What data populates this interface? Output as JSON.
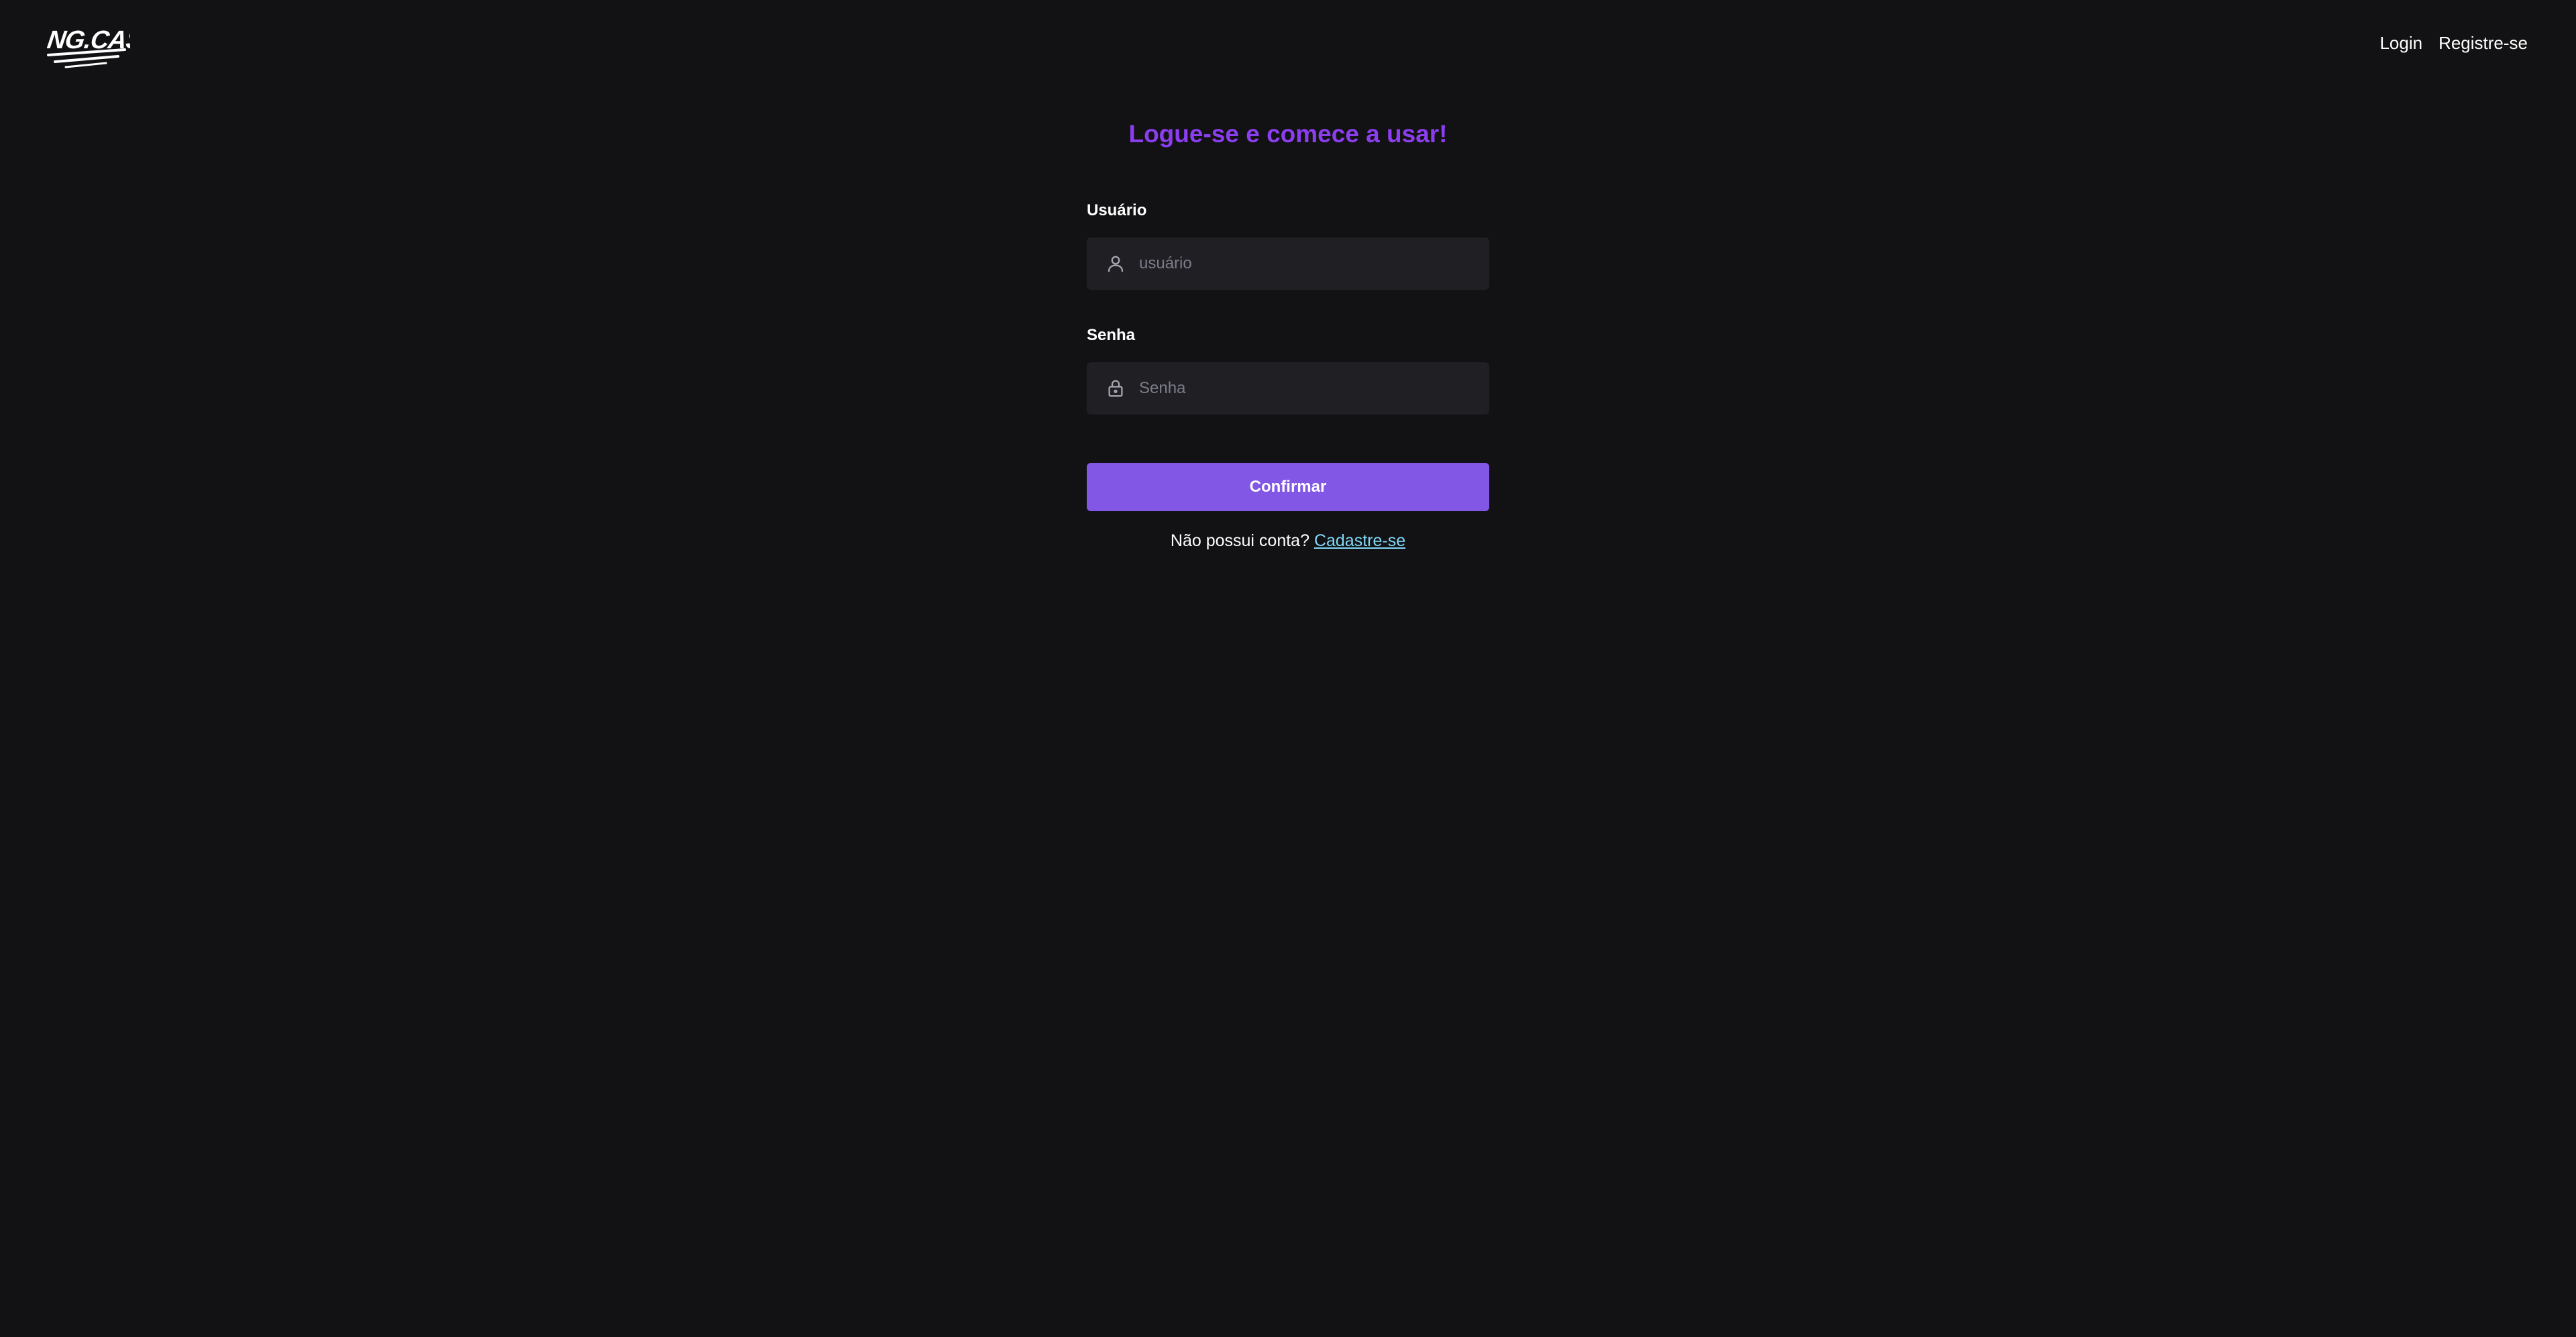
{
  "header": {
    "logo_text": "NG.CASH",
    "nav": {
      "login_label": "Login",
      "register_label": "Registre-se"
    }
  },
  "form": {
    "title": "Logue-se e comece a usar!",
    "username": {
      "label": "Usuário",
      "placeholder": "usuário",
      "value": "",
      "icon": "user-icon"
    },
    "password": {
      "label": "Senha",
      "placeholder": "Senha",
      "value": "",
      "icon": "lock-icon"
    },
    "confirm_label": "Confirmar",
    "signup_prompt": "Não possui conta?",
    "signup_link": "Cadastre-se"
  },
  "colors": {
    "background": "#121214",
    "accent": "#8257e5",
    "title": "#8d3df0",
    "input_bg": "#202024",
    "link": "#81d8f7"
  }
}
